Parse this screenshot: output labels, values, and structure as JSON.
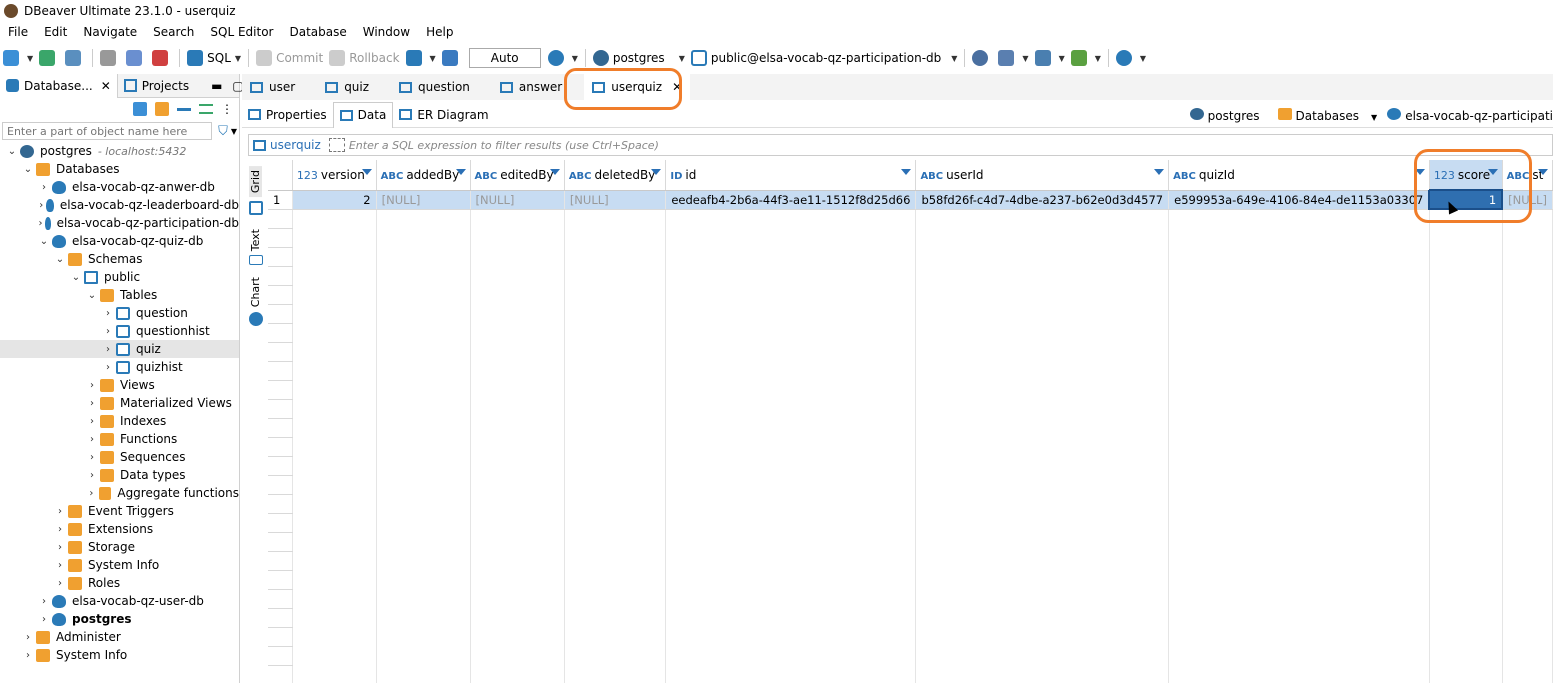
{
  "window": {
    "title": "DBeaver Ultimate 23.1.0 - userquiz"
  },
  "menu": [
    "File",
    "Edit",
    "Navigate",
    "Search",
    "SQL Editor",
    "Database",
    "Window",
    "Help"
  ],
  "toolbar": {
    "sql_label": "SQL",
    "commit_label": "Commit",
    "rollback_label": "Rollback",
    "tx_mode": "Auto",
    "datasource": "postgres",
    "schema": "public@elsa-vocab-qz-participation-db"
  },
  "left_panel": {
    "tabs": [
      {
        "label": "Database...",
        "active": true
      },
      {
        "label": "Projects",
        "active": false
      }
    ],
    "filter_placeholder": "Enter a part of object name here",
    "tree": [
      {
        "label": "postgres",
        "sub": "- localhost:5432",
        "icon": "pg",
        "depth": 0,
        "tw": "⌄"
      },
      {
        "label": "Databases",
        "icon": "folder",
        "depth": 1,
        "tw": "⌄"
      },
      {
        "label": "elsa-vocab-qz-anwer-db",
        "icon": "db",
        "depth": 2,
        "tw": "›"
      },
      {
        "label": "elsa-vocab-qz-leaderboard-db",
        "icon": "db",
        "depth": 2,
        "tw": "›"
      },
      {
        "label": "elsa-vocab-qz-participation-db",
        "icon": "db",
        "depth": 2,
        "tw": "›"
      },
      {
        "label": "elsa-vocab-qz-quiz-db",
        "icon": "db",
        "depth": 2,
        "tw": "⌄"
      },
      {
        "label": "Schemas",
        "icon": "folder",
        "depth": 3,
        "tw": "⌄"
      },
      {
        "label": "public",
        "icon": "schema",
        "depth": 4,
        "tw": "⌄"
      },
      {
        "label": "Tables",
        "icon": "folder",
        "depth": 5,
        "tw": "⌄"
      },
      {
        "label": "question",
        "icon": "table",
        "depth": 6,
        "tw": "›"
      },
      {
        "label": "questionhist",
        "icon": "table",
        "depth": 6,
        "tw": "›"
      },
      {
        "label": "quiz",
        "icon": "table",
        "depth": 6,
        "tw": "›",
        "selected": true
      },
      {
        "label": "quizhist",
        "icon": "table",
        "depth": 6,
        "tw": "›"
      },
      {
        "label": "Views",
        "icon": "folder",
        "depth": 5,
        "tw": "›"
      },
      {
        "label": "Materialized Views",
        "icon": "folder",
        "depth": 5,
        "tw": "›"
      },
      {
        "label": "Indexes",
        "icon": "folder",
        "depth": 5,
        "tw": "›"
      },
      {
        "label": "Functions",
        "icon": "folder",
        "depth": 5,
        "tw": "›"
      },
      {
        "label": "Sequences",
        "icon": "folder",
        "depth": 5,
        "tw": "›"
      },
      {
        "label": "Data types",
        "icon": "folder",
        "depth": 5,
        "tw": "›"
      },
      {
        "label": "Aggregate functions",
        "icon": "folder",
        "depth": 5,
        "tw": "›"
      },
      {
        "label": "Event Triggers",
        "icon": "folder",
        "depth": 3,
        "tw": "›"
      },
      {
        "label": "Extensions",
        "icon": "folder",
        "depth": 3,
        "tw": "›"
      },
      {
        "label": "Storage",
        "icon": "folder",
        "depth": 3,
        "tw": "›"
      },
      {
        "label": "System Info",
        "icon": "folder",
        "depth": 3,
        "tw": "›"
      },
      {
        "label": "Roles",
        "icon": "folder",
        "depth": 3,
        "tw": "›"
      },
      {
        "label": "elsa-vocab-qz-user-db",
        "icon": "db",
        "depth": 2,
        "tw": "›"
      },
      {
        "label": "postgres",
        "icon": "db",
        "depth": 2,
        "tw": "›",
        "bold": true
      },
      {
        "label": "Administer",
        "icon": "folder",
        "depth": 1,
        "tw": "›"
      },
      {
        "label": "System Info",
        "icon": "folder",
        "depth": 1,
        "tw": "›"
      }
    ]
  },
  "editor": {
    "tabs": [
      {
        "label": "user",
        "active": false
      },
      {
        "label": "quiz",
        "active": false
      },
      {
        "label": "question",
        "active": false
      },
      {
        "label": "answer",
        "active": false
      },
      {
        "label": "userquiz",
        "active": true
      }
    ],
    "subtabs": [
      {
        "label": "Properties",
        "active": false
      },
      {
        "label": "Data",
        "active": true
      },
      {
        "label": "ER Diagram",
        "active": false
      }
    ],
    "crumbs": [
      "postgres",
      "Databases",
      "elsa-vocab-qz-participati"
    ],
    "filter_table": "userquiz",
    "filter_placeholder": "Enter a SQL expression to filter results (use Ctrl+Space)",
    "side_tabs": [
      "Grid",
      "Text",
      "Chart"
    ]
  },
  "grid": {
    "columns": [
      {
        "name": "version",
        "type": "123"
      },
      {
        "name": "addedBy",
        "type": "ABC"
      },
      {
        "name": "editedBy",
        "type": "ABC"
      },
      {
        "name": "deletedBy",
        "type": "ABC"
      },
      {
        "name": "id",
        "type": "ID"
      },
      {
        "name": "userId",
        "type": "ABC"
      },
      {
        "name": "quizId",
        "type": "ABC"
      },
      {
        "name": "score",
        "type": "123"
      },
      {
        "name": "st",
        "type": "ABC"
      }
    ],
    "rows": [
      [
        "1",
        "2",
        "[NULL]",
        "[NULL]",
        "[NULL]",
        "eedeafb4-2b6a-44f3-ae11-1512f8d25d66",
        "b58fd26f-c4d7-4dbe-a237-b62e0d3d4577",
        "e599953a-649e-4106-84e4-de1153a03307",
        "1",
        "[NULL]"
      ]
    ]
  },
  "colors": {
    "accent": "#2a6fb5",
    "highlight": "#f07d2a",
    "row_selected": "#c7dcf2"
  }
}
